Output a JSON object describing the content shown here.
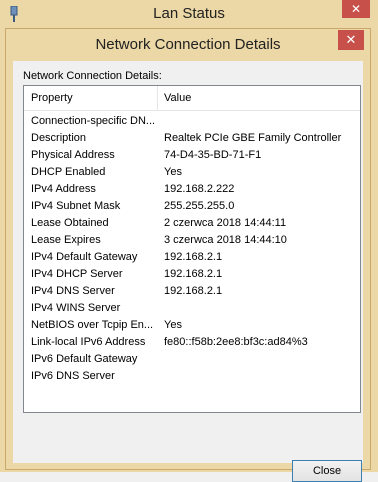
{
  "bg_window": {
    "title": "Lan Status",
    "close_glyph": "✕"
  },
  "dialog": {
    "title": "Network Connection Details",
    "close_glyph": "✕",
    "group_label": "Network Connection Details:",
    "columns": {
      "property": "Property",
      "value": "Value"
    },
    "rows": [
      {
        "property": "Connection-specific DN...",
        "value": ""
      },
      {
        "property": "Description",
        "value": "Realtek PCIe GBE Family Controller"
      },
      {
        "property": "Physical Address",
        "value": "74-D4-35-BD-71-F1"
      },
      {
        "property": "DHCP Enabled",
        "value": "Yes"
      },
      {
        "property": "IPv4 Address",
        "value": "192.168.2.222"
      },
      {
        "property": "IPv4 Subnet Mask",
        "value": "255.255.255.0"
      },
      {
        "property": "Lease Obtained",
        "value": "2 czerwca 2018 14:44:11"
      },
      {
        "property": "Lease Expires",
        "value": "3 czerwca 2018 14:44:10"
      },
      {
        "property": "IPv4 Default Gateway",
        "value": "192.168.2.1"
      },
      {
        "property": "IPv4 DHCP Server",
        "value": "192.168.2.1"
      },
      {
        "property": "IPv4 DNS Server",
        "value": "192.168.2.1"
      },
      {
        "property": "IPv4 WINS Server",
        "value": ""
      },
      {
        "property": "NetBIOS over Tcpip En...",
        "value": "Yes"
      },
      {
        "property": "Link-local IPv6 Address",
        "value": "fe80::f58b:2ee8:bf3c:ad84%3"
      },
      {
        "property": "IPv6 Default Gateway",
        "value": ""
      },
      {
        "property": "IPv6 DNS Server",
        "value": ""
      }
    ],
    "close_button": "Close"
  },
  "colors": {
    "frame": "#ecd7a6",
    "close_red": "#c7504a",
    "client": "#f0f0f0",
    "button_border": "#3c7fb1"
  }
}
